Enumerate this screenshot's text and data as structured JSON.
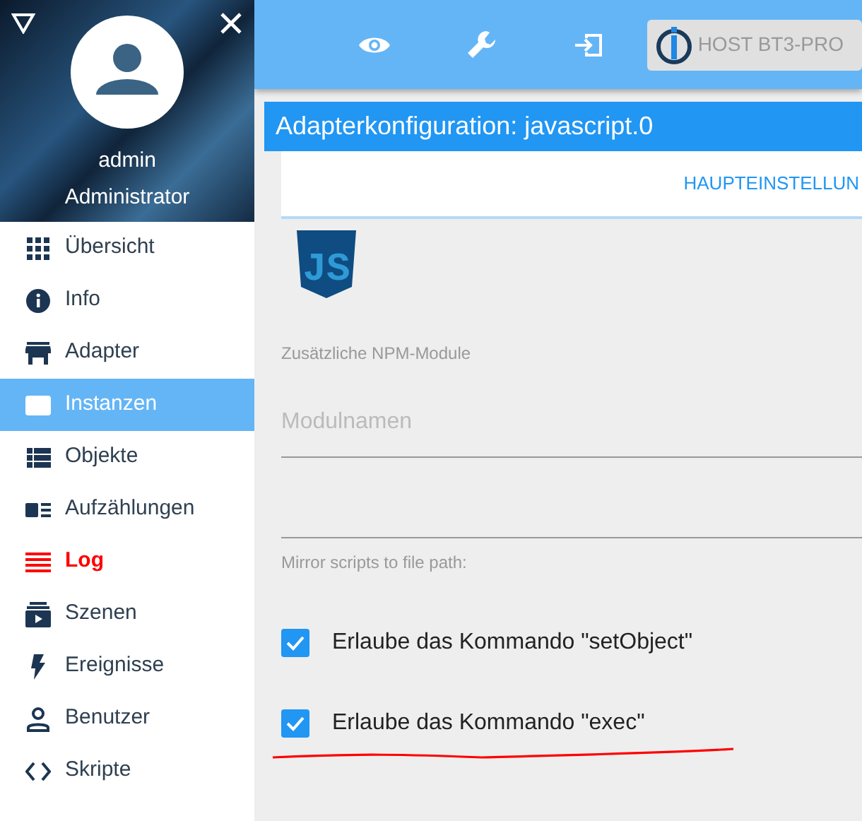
{
  "sidebar": {
    "user": {
      "name": "admin",
      "role": "Administrator"
    },
    "items": [
      {
        "label": "Übersicht",
        "selected": false,
        "emphasized": false
      },
      {
        "label": "Info",
        "selected": false,
        "emphasized": false
      },
      {
        "label": "Adapter",
        "selected": false,
        "emphasized": false
      },
      {
        "label": "Instanzen",
        "selected": true,
        "emphasized": false
      },
      {
        "label": "Objekte",
        "selected": false,
        "emphasized": false
      },
      {
        "label": "Aufzählungen",
        "selected": false,
        "emphasized": false
      },
      {
        "label": "Log",
        "selected": false,
        "emphasized": true
      },
      {
        "label": "Szenen",
        "selected": false,
        "emphasized": false
      },
      {
        "label": "Ereignisse",
        "selected": false,
        "emphasized": false
      },
      {
        "label": "Benutzer",
        "selected": false,
        "emphasized": false
      },
      {
        "label": "Skripte",
        "selected": false,
        "emphasized": false
      }
    ]
  },
  "toolbar": {
    "host_button": "HOST BT3-PRO"
  },
  "dialog": {
    "title": "Adapterkonfiguration: javascript.0",
    "tabs": [
      {
        "label": "HAUPTEINSTELLUN",
        "selected": true
      }
    ],
    "logo_text": "JS",
    "npm_label": "Zusätzliche NPM-Module",
    "npm_placeholder": "Modulnamen",
    "mirror_label": "Mirror scripts to file path:",
    "options": [
      {
        "label": "Erlaube das Kommando \"setObject\"",
        "checked": true
      },
      {
        "label": "Erlaube das Kommando \"exec\"",
        "checked": true
      }
    ]
  }
}
